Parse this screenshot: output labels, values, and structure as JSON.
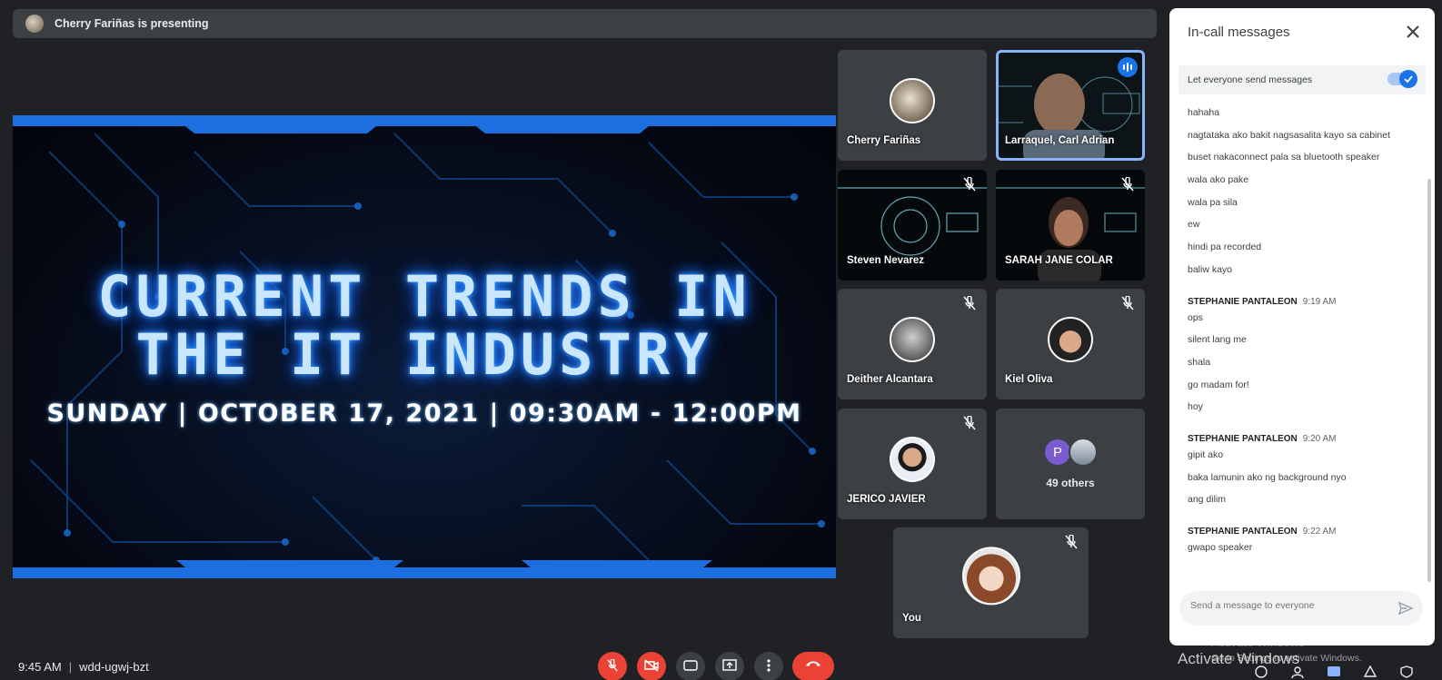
{
  "banner": {
    "presenter_text": "Cherry Fariñas is presenting"
  },
  "slide": {
    "title_line1": "CURRENT TRENDS IN",
    "title_line2": "THE IT INDUSTRY",
    "subtitle": "SUNDAY | OCTOBER 17, 2021 | 09:30AM - 12:00PM"
  },
  "participants": [
    {
      "name": "Cherry Fariñas"
    },
    {
      "name": "Larraquel, Carl Adrian"
    },
    {
      "name": "Steven Nevarez"
    },
    {
      "name": "SARAH JANE COLAR"
    },
    {
      "name": "Deither Alcantara"
    },
    {
      "name": "Kiel Oliva"
    },
    {
      "name": "JERICO JAVIER"
    },
    {
      "name": "You"
    }
  ],
  "others": {
    "initial": "P",
    "label": "49 others"
  },
  "chat": {
    "title": "In-call messages",
    "toggle_label": "Let everyone send messages",
    "first_group": [
      "hahaha",
      "nagtataka ako bakit  nagsasalita kayo sa cabinet",
      "buset nakaconnect pala sa bluetooth speaker",
      "wala ako pake",
      "wala pa sila",
      "ew",
      "hindi pa recorded",
      "baliw kayo"
    ],
    "groups": [
      {
        "sender": "STEPHANIE PANTALEON",
        "time": "9:19 AM",
        "messages": [
          "ops",
          "silent lang me",
          "shala",
          "go madam for!",
          "hoy"
        ]
      },
      {
        "sender": "STEPHANIE PANTALEON",
        "time": "9:20 AM",
        "messages": [
          "gipit ako",
          "baka lamunin ako ng background nyo",
          "ang dilim"
        ]
      },
      {
        "sender": "STEPHANIE PANTALEON",
        "time": "9:22 AM",
        "messages": [
          "gwapo speaker"
        ]
      }
    ],
    "compose_placeholder": "Send a message to everyone"
  },
  "meeting": {
    "time": "9:45 AM",
    "code": "wdd-ugwj-bzt"
  },
  "watermark": {
    "title": "Activate Windows",
    "ghost": "Activate Windows",
    "hint": "Go to Settings to activate Windows."
  },
  "colors": {
    "accent": "#1a73e8",
    "danger": "#ea4335",
    "tile_bg": "#3c4043",
    "page_bg": "#202124"
  }
}
